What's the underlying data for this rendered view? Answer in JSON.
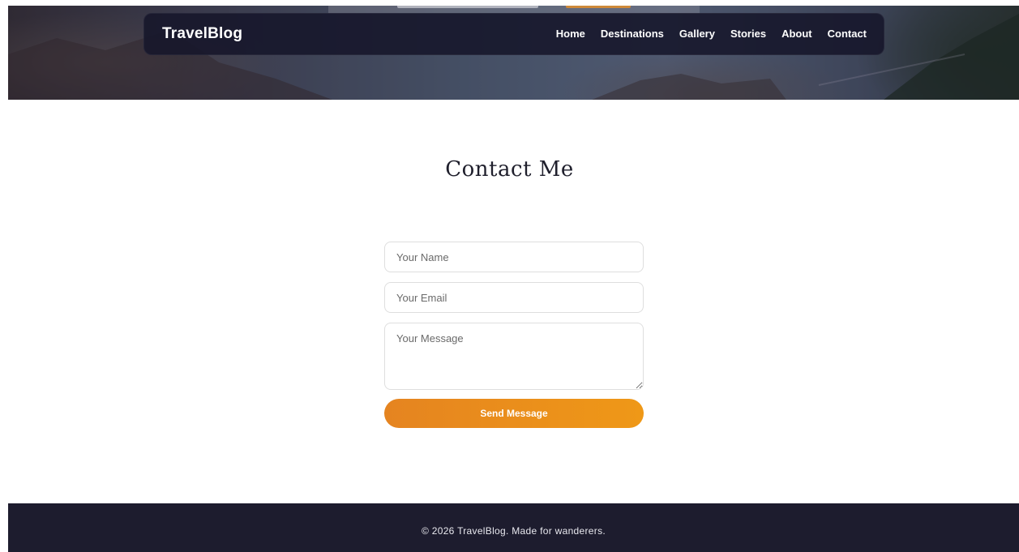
{
  "header": {
    "brand": "TravelBlog",
    "nav": [
      {
        "label": "Home"
      },
      {
        "label": "Destinations"
      },
      {
        "label": "Gallery"
      },
      {
        "label": "Stories"
      },
      {
        "label": "About"
      },
      {
        "label": "Contact"
      }
    ]
  },
  "contact": {
    "title": "Contact Me",
    "name_placeholder": "Your Name",
    "email_placeholder": "Your Email",
    "message_placeholder": "Your Message",
    "submit_label": "Send Message"
  },
  "footer": {
    "text": "© 2026 TravelBlog. Made for wanderers."
  },
  "colors": {
    "accent_start": "#e58420",
    "accent_end": "#ef9817",
    "navbar_bg": "#16162a",
    "footer_bg": "#1d1c2e",
    "title_text": "#1f1f2c"
  }
}
